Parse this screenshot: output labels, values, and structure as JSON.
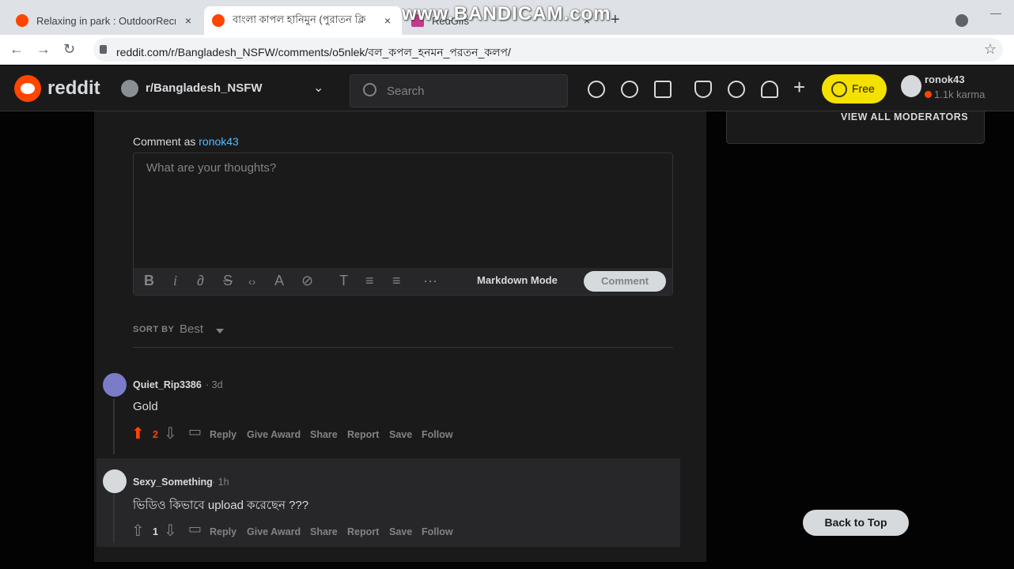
{
  "browser": {
    "tabs": [
      {
        "title": "Relaxing in park : OutdoorRecrea",
        "close": "×"
      },
      {
        "title": "বাংলা কাপল হানিমুন (পুরাতন ক্লি",
        "close": "×"
      },
      {
        "title": "RedGifs",
        "close": "×"
      }
    ],
    "new_tab": "+",
    "watermark": "www.BANDICAM.com",
    "url": "reddit.com/r/Bangladesh_NSFW/comments/o5nlek/বল_কপল_হনমন_পরতন_কলপ/",
    "back": "←",
    "forward": "→",
    "reload": "↻",
    "star": "☆",
    "minimize": "—"
  },
  "header": {
    "wordmark": "reddit",
    "subreddit": "r/Bangladesh_NSFW",
    "search_placeholder": "Search",
    "free_label": "Free",
    "username": "ronok43",
    "karma": "1.1k karma",
    "icons": [
      "popular-icon",
      "stats-icon",
      "video-icon",
      "mod-shield-icon",
      "chat-icon",
      "bell-icon",
      "plus-icon"
    ]
  },
  "sidebar": {
    "view_all_mods": "VIEW ALL MODERATORS"
  },
  "composer": {
    "comment_as": "Comment as",
    "username": "ronok43",
    "placeholder": "What are your thoughts?",
    "markdown_mode": "Markdown Mode",
    "comment_button": "Comment"
  },
  "sort": {
    "label": "SORT BY",
    "value": "Best"
  },
  "comments": [
    {
      "author": "Quiet_Rip3386",
      "time": "· 3d",
      "body": "Gold",
      "votes": "2",
      "actions": [
        "Reply",
        "Give Award",
        "Share",
        "Report",
        "Save",
        "Follow"
      ]
    },
    {
      "author": "Sexy_Something",
      "time": "· 1h",
      "body": "ভিডিও কিভাবে upload করেছেন ???",
      "votes": "1",
      "actions": [
        "Reply",
        "Give Award",
        "Share",
        "Report",
        "Save",
        "Follow"
      ]
    }
  ],
  "back_to_top": "Back to Top",
  "colors": {
    "brand": "#ff4500",
    "upvoted": "#ff4500",
    "link": "#4fbcff",
    "bg": "#030303",
    "card": "#1a1a1b"
  }
}
